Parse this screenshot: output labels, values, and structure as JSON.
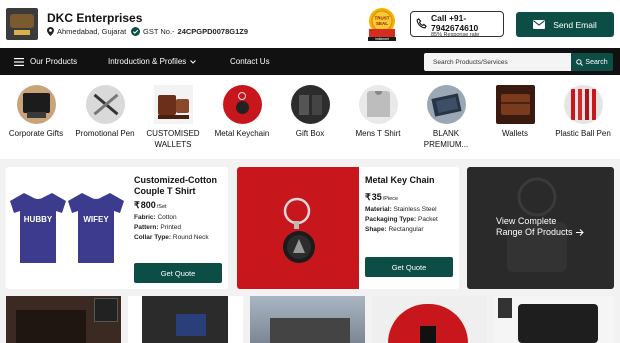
{
  "header": {
    "company_name": "DKC Enterprises",
    "location": "Ahmedabad, Gujarat",
    "gst_label": "GST No.-",
    "gst_number": "24CPGPD0078G1Z9",
    "trust_badge": "TRUST SEAL indiamart",
    "call_label": "Call +91-7942674610",
    "response_rate": "85% Response rate",
    "send_email": "Send Email"
  },
  "nav": {
    "items": [
      {
        "label": "Our Products"
      },
      {
        "label": "Introduction & Profiles"
      },
      {
        "label": "Contact Us"
      }
    ],
    "search_placeholder": "Search Products/Services",
    "search_button": "Search"
  },
  "categories": [
    {
      "label": "Corporate Gifts"
    },
    {
      "label": "Promotional Pen"
    },
    {
      "label": "CUSTOMISED WALLETS"
    },
    {
      "label": "Metal Keychain"
    },
    {
      "label": "Gift Box"
    },
    {
      "label": "Mens T Shirt"
    },
    {
      "label": "BLANK PREMIUM..."
    },
    {
      "label": "Wallets"
    },
    {
      "label": "Plastic Ball Pen"
    }
  ],
  "products": [
    {
      "title": "Customized-Cotton Couple T Shirt",
      "price": "800",
      "unit": "/Set",
      "specs": [
        {
          "k": "Fabric:",
          "v": "Cotton"
        },
        {
          "k": "Pattern:",
          "v": "Printed"
        },
        {
          "k": "Collar Type:",
          "v": "Round Neck"
        }
      ],
      "cta": "Get Quote",
      "tshirt_left": "HUBBY",
      "tshirt_right": "WIFEY"
    },
    {
      "title": "Metal Key Chain",
      "price": "35",
      "unit": "/Piece",
      "specs": [
        {
          "k": "Material:",
          "v": "Stainless Steel"
        },
        {
          "k": "Packaging Type:",
          "v": "Packet"
        },
        {
          "k": "Shape:",
          "v": "Rectangular"
        }
      ],
      "cta": "Get Quote"
    }
  ],
  "view_all": {
    "line1": "View Complete",
    "line2": "Range Of Products"
  },
  "colors": {
    "brand": "#0c4e45",
    "nav": "#111111"
  }
}
